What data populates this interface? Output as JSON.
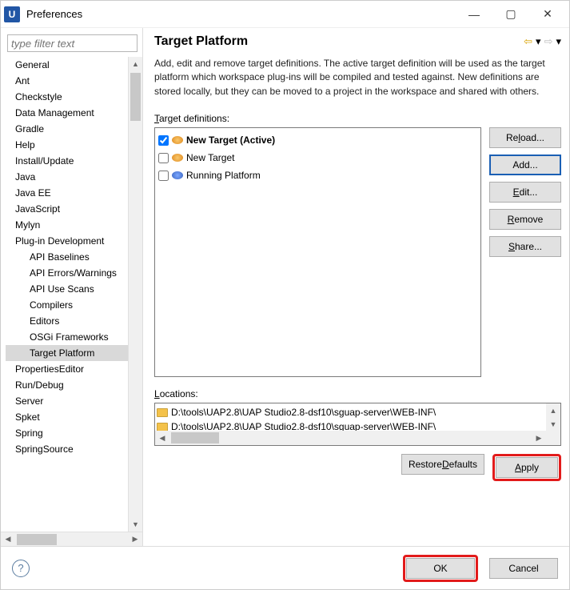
{
  "window": {
    "title": "Preferences"
  },
  "filter": {
    "placeholder": "type filter text"
  },
  "tree": {
    "items": [
      {
        "label": "General",
        "level": 0
      },
      {
        "label": "Ant",
        "level": 0
      },
      {
        "label": "Checkstyle",
        "level": 0
      },
      {
        "label": "Data Management",
        "level": 0
      },
      {
        "label": "Gradle",
        "level": 0
      },
      {
        "label": "Help",
        "level": 0
      },
      {
        "label": "Install/Update",
        "level": 0
      },
      {
        "label": "Java",
        "level": 0
      },
      {
        "label": "Java EE",
        "level": 0
      },
      {
        "label": "JavaScript",
        "level": 0
      },
      {
        "label": "Mylyn",
        "level": 0
      },
      {
        "label": "Plug-in Development",
        "level": 0
      },
      {
        "label": "API Baselines",
        "level": 1
      },
      {
        "label": "API Errors/Warnings",
        "level": 1
      },
      {
        "label": "API Use Scans",
        "level": 1
      },
      {
        "label": "Compilers",
        "level": 1
      },
      {
        "label": "Editors",
        "level": 1
      },
      {
        "label": "OSGi Frameworks",
        "level": 1
      },
      {
        "label": "Target Platform",
        "level": 1,
        "selected": true
      },
      {
        "label": "PropertiesEditor",
        "level": 0
      },
      {
        "label": "Run/Debug",
        "level": 0
      },
      {
        "label": "Server",
        "level": 0
      },
      {
        "label": "Spket",
        "level": 0
      },
      {
        "label": "Spring",
        "level": 0
      },
      {
        "label": "SpringSource",
        "level": 0
      }
    ]
  },
  "page": {
    "title": "Target Platform",
    "description": "Add, edit and remove target definitions.  The active target definition will be used as the target platform which workspace plug-ins will be compiled and tested against.  New definitions are stored locally, but they can be moved to a project in the workspace and shared with others.",
    "defs_label_pre": "T",
    "defs_label_post": "arget definitions:",
    "definitions": [
      {
        "name": "New Target (Active)",
        "checked": true,
        "bold": true,
        "icon": "orange"
      },
      {
        "name": "New Target",
        "checked": false,
        "bold": false,
        "icon": "orange"
      },
      {
        "name": "Running Platform",
        "checked": false,
        "bold": false,
        "icon": "blue"
      }
    ],
    "buttons": {
      "reload_pre": "Re",
      "reload_u": "l",
      "reload_post": "oad...",
      "add": "Add...",
      "edit_u": "E",
      "edit_post": "dit...",
      "remove_u": "R",
      "remove_post": "emove",
      "share_u": "S",
      "share_post": "hare..."
    },
    "loc_label_pre": "L",
    "loc_label_post": "ocations:",
    "locations": [
      "D:\\tools\\UAP2.8\\UAP Studio2.8-dsf10\\sguap-server\\WEB-INF\\",
      "D:\\tools\\UAP2.8\\UAP Studio2.8-dsf10\\sguap-server\\WEB-INF\\"
    ],
    "restore_pre": "Restore ",
    "restore_u": "D",
    "restore_post": "efaults",
    "apply_u": "A",
    "apply_post": "pply"
  },
  "footer": {
    "ok": "OK",
    "cancel": "Cancel"
  }
}
